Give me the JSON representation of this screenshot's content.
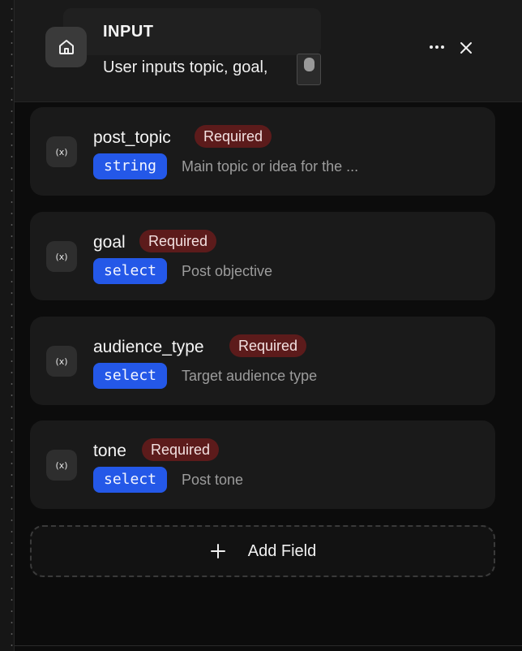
{
  "node": {
    "title": "INPUT",
    "description": "User inputs topic, goal,"
  },
  "actions": {
    "more_icon": "more-horizontal-icon",
    "close_icon": "close-icon"
  },
  "fields": [
    {
      "name": "post_topic",
      "required_label": "Required",
      "type": "string",
      "description": "Main topic or idea for the ..."
    },
    {
      "name": "goal",
      "required_label": "Required",
      "type": "select",
      "description": "Post objective"
    },
    {
      "name": "audience_type",
      "required_label": "Required",
      "type": "select",
      "description": "Target audience type"
    },
    {
      "name": "tone",
      "required_label": "Required",
      "type": "select",
      "description": "Post tone"
    }
  ],
  "add_field": {
    "label": "Add Field"
  },
  "colors": {
    "type_badge": "#2458e8",
    "required_badge": "#5c1b1b",
    "card": "#1a1a1a"
  }
}
